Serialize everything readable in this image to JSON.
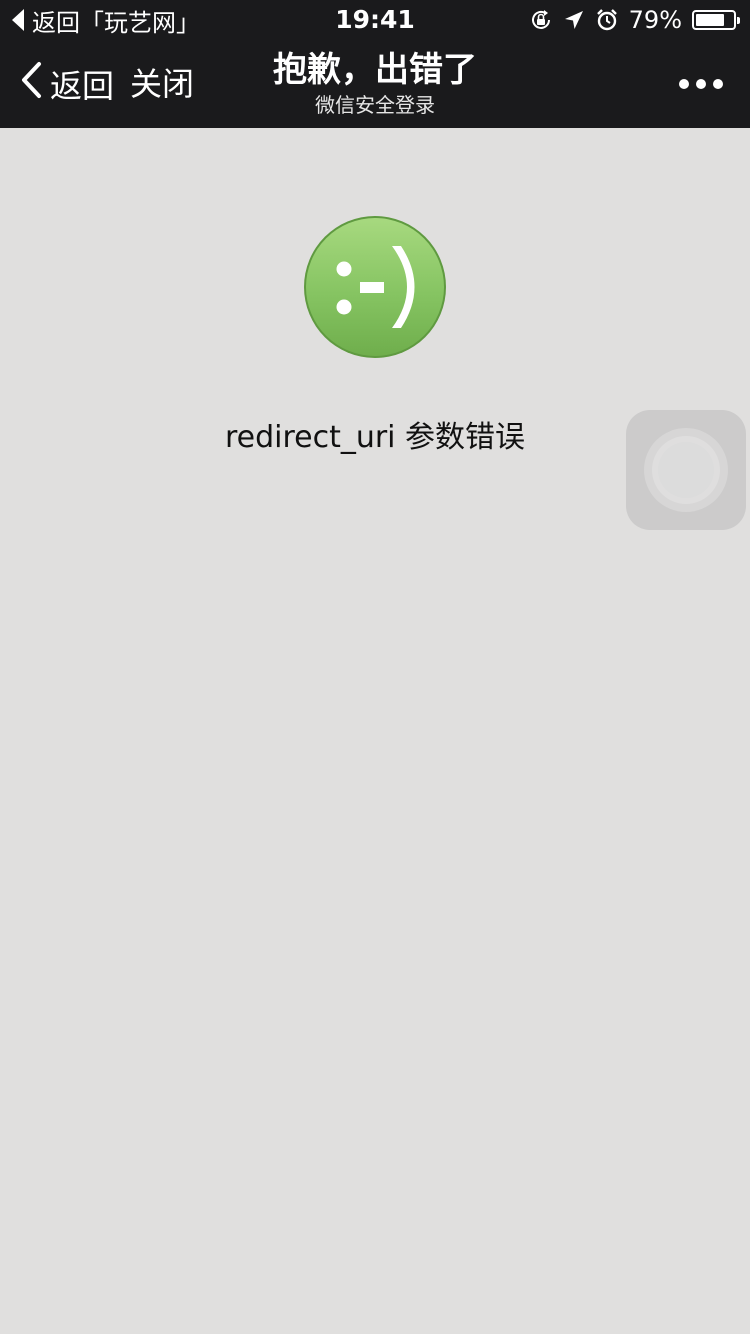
{
  "status_bar": {
    "back_app_label": "返回「玩艺网」",
    "time": "19:41",
    "battery_percent_text": "79%",
    "battery_level": 0.79,
    "icons": [
      "orientation-lock-icon",
      "location-arrow-icon",
      "alarm-clock-icon",
      "battery-icon"
    ]
  },
  "nav": {
    "back_label": "返回",
    "close_label": "关闭",
    "title": "抱歉，出错了",
    "subtitle": "微信安全登录",
    "more_icon": "more-dots-icon"
  },
  "content": {
    "logo_icon": "smiley-logo-icon",
    "logo_text": ":-)",
    "message": "redirect_uri 参数错误"
  },
  "colors": {
    "nav_background": "#1a1a1c",
    "page_background": "#e0dfde",
    "logo_green": "#7dc05a"
  }
}
